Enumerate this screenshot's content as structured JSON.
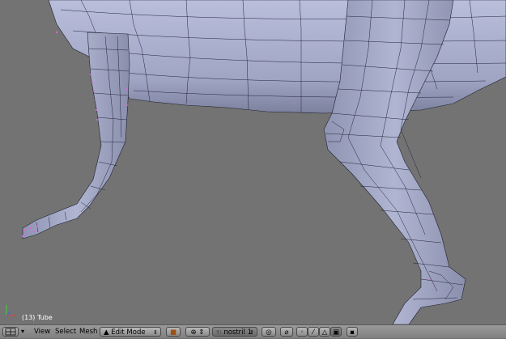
{
  "viewport": {
    "object_info": "(13) Tube"
  },
  "header": {
    "menus": [
      "View",
      "Select",
      "Mesh"
    ],
    "mode": {
      "label": "Edit Mode"
    },
    "layer_field": {
      "value": "nostril 1"
    },
    "icons": [
      "editor-type-icon",
      "collapse-arrow-icon",
      "mode-icon",
      "draw-type-icon",
      "pivot-icon",
      "manipulator-icon",
      "hand-icon",
      "proportional-icon",
      "snap-icon",
      "vertex-select-icon",
      "edge-select-icon",
      "face-select-icon",
      "occlude-icon",
      "render-icon"
    ]
  },
  "colors": {
    "viewport_bg": "#737373",
    "mesh_fill": "#a3a8c6",
    "wire": "#1e2030",
    "selected_vertex": "#e070e0",
    "header_bg": "#8a8a8a"
  }
}
